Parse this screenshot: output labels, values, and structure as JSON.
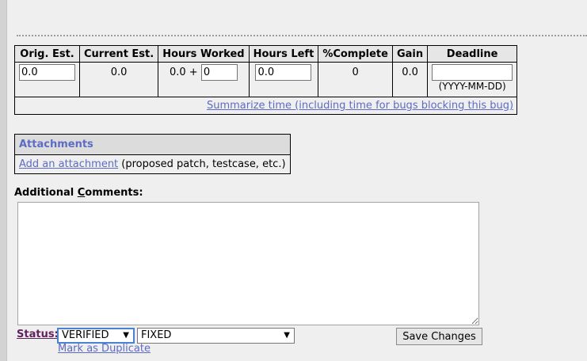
{
  "time_tracking": {
    "headers": [
      "Orig. Est.",
      "Current Est.",
      "Hours Worked",
      "Hours Left",
      "%Complete",
      "Gain",
      "Deadline"
    ],
    "orig_est": "0.0",
    "current_est": "0.0",
    "hours_worked_prefix": "0.0 +",
    "hours_worked_input": "0",
    "hours_left": "0.0",
    "percent_complete": "0",
    "gain": "0.0",
    "deadline_value": "",
    "deadline_format": "(YYYY-MM-DD)",
    "summarize_link": "Summarize time (including time for bugs blocking this bug)"
  },
  "attachments": {
    "header": "Attachments",
    "add_link": "Add an attachment",
    "add_note": "(proposed patch, testcase, etc.)"
  },
  "comments": {
    "label_pre": "Additional ",
    "label_accesskey": "C",
    "label_post": "omments:",
    "value": ""
  },
  "status": {
    "label": "Status:",
    "status_value": "VERIFIED",
    "resolution_value": "FIXED",
    "duplicate_link": "Mark as Duplicate"
  },
  "save_button": "Save Changes"
}
